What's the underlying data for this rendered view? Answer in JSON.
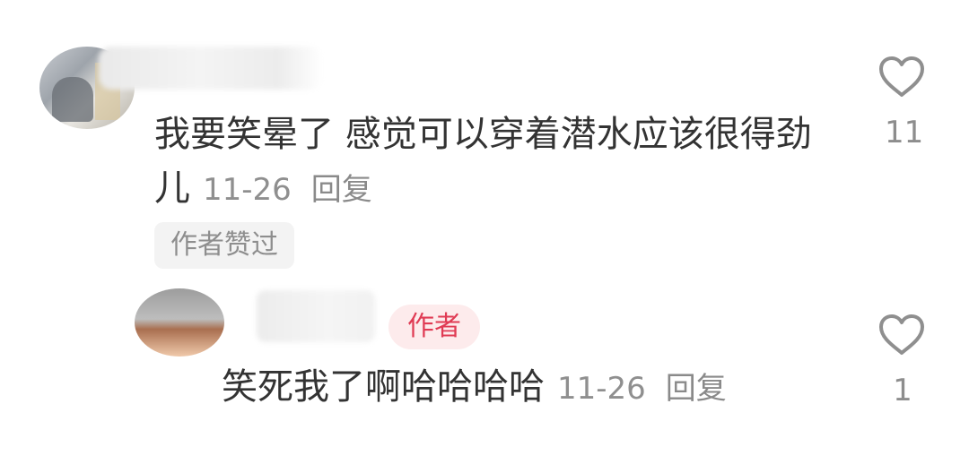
{
  "comment": {
    "text": "我要笑晕了 感觉可以穿着潜水应该很得劲儿",
    "date": "11-26",
    "reply_label": "回复",
    "like_count": "11",
    "author_liked_badge": "作者赞过",
    "icons": {
      "like": "heart-outline-icon"
    }
  },
  "reply": {
    "badge": "作者",
    "text": "笑死我了啊哈哈哈哈",
    "date": "11-26",
    "reply_label": "回复",
    "like_count": "1",
    "icons": {
      "like": "heart-outline-icon"
    }
  },
  "colors": {
    "text": "#333333",
    "muted": "#8f8f8f",
    "badge_bg": "#fdebec",
    "badge_text": "#e03b54",
    "tag_bg": "#f3f3f3"
  }
}
